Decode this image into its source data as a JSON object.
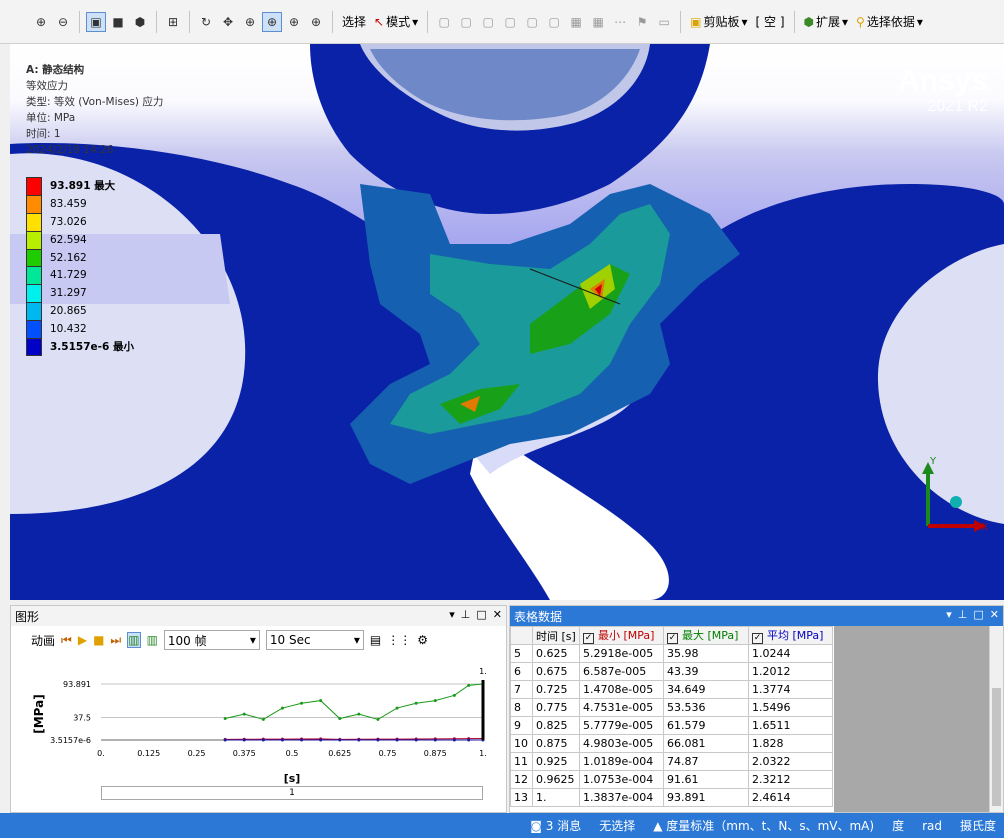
{
  "toolbar": {
    "select_label": "选择",
    "mode_label": "模式",
    "clipboard_label": "剪贴板",
    "empty_label": "[ 空 ]",
    "extend_label": "扩展",
    "select_by_label": "选择依据"
  },
  "viewport": {
    "info": {
      "line1": "A: 静态结构",
      "line2": "等效应力",
      "line3": "类型: 等效 (Von-Mises) 应力",
      "line4": "单位: MPa",
      "line5": "时间: 1",
      "line6": "2024/2/18 14:26"
    },
    "legend": [
      {
        "value": "93.891 最大",
        "color": "#ff0000"
      },
      {
        "value": "83.459",
        "color": "#ff8c00"
      },
      {
        "value": "73.026",
        "color": "#ffe000"
      },
      {
        "value": "62.594",
        "color": "#b8ee00"
      },
      {
        "value": "52.162",
        "color": "#1ecc00"
      },
      {
        "value": "41.729",
        "color": "#00e79a"
      },
      {
        "value": "31.297",
        "color": "#00f0ee"
      },
      {
        "value": "20.865",
        "color": "#00b8f0"
      },
      {
        "value": "10.432",
        "color": "#0050ff"
      },
      {
        "value": "3.5157e-6 最小",
        "color": "#0000c8"
      }
    ],
    "brand": {
      "name": "Ansys",
      "version": "2021 R2"
    },
    "triad": {
      "y": "Y",
      "x": "X"
    }
  },
  "graph_panel": {
    "title": "图形",
    "anim_label": "动画",
    "frames": "100 帧",
    "duration": "10 Sec",
    "y_axis_label": "[MPa]",
    "x_axis_label": "[s]",
    "scrollbar_value": "1",
    "top_marker": "1.",
    "chart_data": {
      "type": "line",
      "x_ticks": [
        "0.",
        "0.125",
        "0.25",
        "0.375",
        "0.5",
        "0.625",
        "0.75",
        "0.875",
        "1."
      ],
      "y_ticks": [
        "93.891",
        "37.5",
        "3.5157e-6"
      ],
      "xlim": [
        0,
        1
      ],
      "ylim": [
        0,
        93.891
      ],
      "series": [
        {
          "values": [
            [
              0.325,
              35.98
            ],
            [
              0.375,
              43.39
            ],
            [
              0.425,
              34.649
            ],
            [
              0.475,
              53.536
            ],
            [
              0.525,
              61.579
            ],
            [
              0.575,
              66.081
            ],
            [
              0.625,
              35.98
            ],
            [
              0.675,
              43.39
            ],
            [
              0.725,
              34.649
            ],
            [
              0.775,
              53.536
            ],
            [
              0.825,
              61.579
            ],
            [
              0.875,
              66.081
            ],
            [
              0.925,
              74.87
            ],
            [
              0.9625,
              91.61
            ],
            [
              1,
              93.891
            ]
          ],
          "color": "#1a9a1a"
        },
        {
          "values": [
            [
              0.325,
              1.0244
            ],
            [
              0.375,
              1.2012
            ],
            [
              0.425,
              1.3774
            ],
            [
              0.475,
              1.5496
            ],
            [
              0.525,
              1.6511
            ],
            [
              0.575,
              1.828
            ],
            [
              0.625,
              1.0244
            ],
            [
              0.675,
              1.2012
            ],
            [
              0.725,
              1.3774
            ],
            [
              0.775,
              1.5496
            ],
            [
              0.825,
              1.6511
            ],
            [
              0.875,
              1.828
            ],
            [
              0.925,
              2.0322
            ],
            [
              0.9625,
              2.3212
            ],
            [
              1,
              2.4614
            ]
          ],
          "color": "#b00030"
        },
        {
          "values": [
            [
              0.325,
              0
            ],
            [
              0.375,
              0
            ],
            [
              0.425,
              0
            ],
            [
              0.475,
              0
            ],
            [
              0.525,
              0
            ],
            [
              0.575,
              0
            ],
            [
              0.625,
              0
            ],
            [
              0.675,
              0
            ],
            [
              0.725,
              0
            ],
            [
              0.775,
              0
            ],
            [
              0.825,
              0
            ],
            [
              0.875,
              0
            ],
            [
              0.925,
              0
            ],
            [
              0.9625,
              0
            ],
            [
              1,
              0
            ]
          ],
          "color": "#1a1aa0"
        }
      ]
    }
  },
  "table_panel": {
    "title": "表格数据",
    "headers": [
      "",
      "时间 [s]",
      "最小 [MPa]",
      "最大 [MPa]",
      "平均 [MPa]"
    ],
    "rows": [
      [
        "5",
        "0.625",
        "5.2918e-005",
        "35.98",
        "1.0244"
      ],
      [
        "6",
        "0.675",
        "6.587e-005",
        "43.39",
        "1.2012"
      ],
      [
        "7",
        "0.725",
        "1.4708e-005",
        "34.649",
        "1.3774"
      ],
      [
        "8",
        "0.775",
        "4.7531e-005",
        "53.536",
        "1.5496"
      ],
      [
        "9",
        "0.825",
        "5.7779e-005",
        "61.579",
        "1.6511"
      ],
      [
        "10",
        "0.875",
        "4.9803e-005",
        "66.081",
        "1.828"
      ],
      [
        "11",
        "0.925",
        "1.0189e-004",
        "74.87",
        "2.0322"
      ],
      [
        "12",
        "0.9625",
        "1.0753e-004",
        "91.61",
        "2.3212"
      ],
      [
        "13",
        "1.",
        "1.3837e-004",
        "93.891",
        "2.4614"
      ]
    ],
    "header_colors": [
      "#000",
      "#000",
      "#c00000",
      "#008000",
      "#0000c0"
    ]
  },
  "statusbar": {
    "messages": "3 消息",
    "selection": "无选择",
    "units": "度量标准（mm、t、N、s、mV、mA)",
    "angle": "度",
    "rad": "rad",
    "temp": "摄氏度"
  }
}
